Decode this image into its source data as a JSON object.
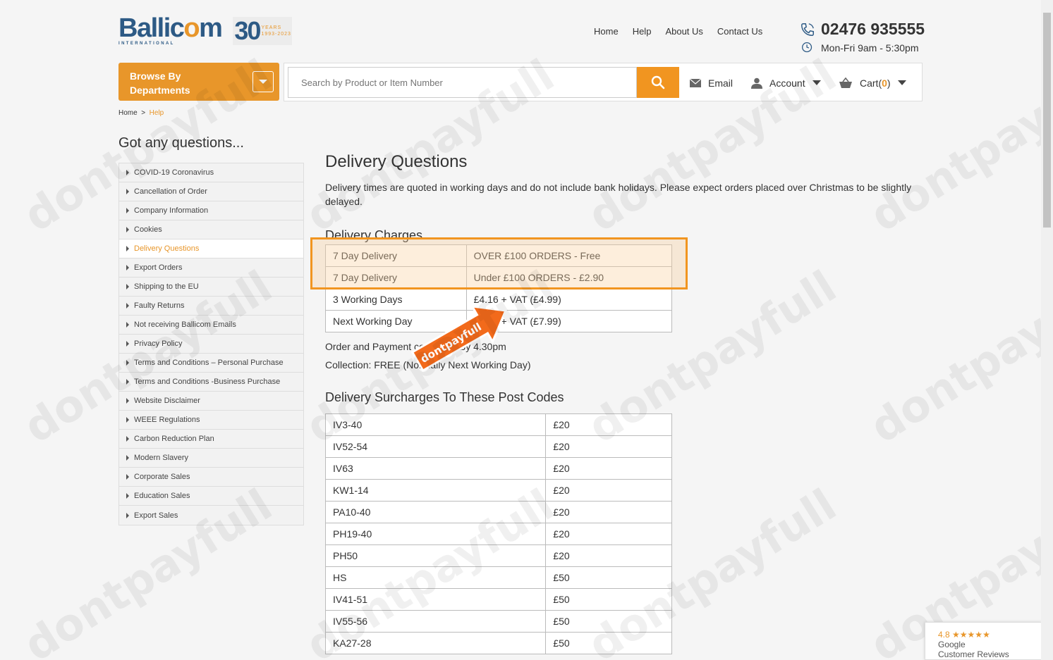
{
  "header": {
    "logo_text_1": "Ballic",
    "logo_text_o": "o",
    "logo_text_2": "m",
    "logo_sub": "INTERNATIONAL",
    "logo_30": "30",
    "logo_years_1": "YEARS",
    "logo_years_2": "1993-2023",
    "nav": [
      "Home",
      "Help",
      "About Us",
      "Contact Us"
    ],
    "phone": "02476 935555",
    "hours": "Mon-Fri 9am - 5:30pm"
  },
  "toolbar": {
    "browse_label": "Browse By Departments",
    "search_placeholder": "Search by Product or Item Number",
    "email_label": "Email",
    "account_label": "Account",
    "cart_label": "Cart(",
    "cart_count": "0",
    "cart_close": ")"
  },
  "breadcrumb": {
    "home": "Home",
    "sep": ">",
    "current": "Help"
  },
  "sidebar": {
    "title": "Got any questions...",
    "items": [
      {
        "label": "COVID-19 Coronavirus",
        "active": false
      },
      {
        "label": "Cancellation of Order",
        "active": false
      },
      {
        "label": "Company Information",
        "active": false
      },
      {
        "label": "Cookies",
        "active": false
      },
      {
        "label": "Delivery Questions",
        "active": true
      },
      {
        "label": "Export Orders",
        "active": false
      },
      {
        "label": "Shipping to the EU",
        "active": false
      },
      {
        "label": "Faulty Returns",
        "active": false
      },
      {
        "label": "Not receiving Ballicom Emails",
        "active": false
      },
      {
        "label": "Privacy Policy",
        "active": false
      },
      {
        "label": "Terms and Conditions – Personal Purchase",
        "active": false
      },
      {
        "label": "Terms and Conditions -Business Purchase",
        "active": false
      },
      {
        "label": "Website Disclaimer",
        "active": false
      },
      {
        "label": "WEEE Regulations",
        "active": false
      },
      {
        "label": "Carbon Reduction Plan",
        "active": false
      },
      {
        "label": "Modern Slavery",
        "active": false
      },
      {
        "label": "Corporate Sales",
        "active": false
      },
      {
        "label": "Education Sales",
        "active": false
      },
      {
        "label": "Export Sales",
        "active": false
      }
    ]
  },
  "main": {
    "title": "Delivery Questions",
    "intro": "Delivery times are quoted in working days and do not include bank holidays. Please expect orders placed over Christmas to be slightly delayed.",
    "charges_title": "Delivery Charges",
    "charges": [
      [
        "7 Day Delivery",
        "OVER £100 ORDERS - Free"
      ],
      [
        "7 Day Delivery",
        "Under £100 ORDERS - £2.90"
      ],
      [
        "3 Working Days",
        "£4.16 + VAT (£4.99)"
      ],
      [
        "Next Working Day",
        "£6.66 + VAT (£7.99)"
      ]
    ],
    "order_note": "Order and Payment confirmed by 4.30pm",
    "collection_note": "Collection: FREE (Normally Next Working Day)",
    "surcharge_title": "Delivery Surcharges To These Post Codes",
    "surcharges": [
      [
        "IV3-40",
        "£20"
      ],
      [
        "IV52-54",
        "£20"
      ],
      [
        "IV63",
        "£20"
      ],
      [
        "KW1-14",
        "£20"
      ],
      [
        "PA10-40",
        "£20"
      ],
      [
        "PH19-40",
        "£20"
      ],
      [
        "PH50",
        "£20"
      ],
      [
        "HS",
        "£50"
      ],
      [
        "IV41-51",
        "£50"
      ],
      [
        "IV55-56",
        "£50"
      ],
      [
        "KA27-28",
        "£50"
      ]
    ]
  },
  "overlay": {
    "arrow_text": "dontpayfull",
    "watermark": "dontpayfull"
  },
  "review_badge": {
    "rating": "4.8",
    "stars": "★★★★★",
    "source": "Google",
    "caption": "Customer Reviews"
  },
  "colors": {
    "brand_orange": "#e8962a",
    "brand_blue": "#2d5a85",
    "highlight_border": "#f19520"
  }
}
